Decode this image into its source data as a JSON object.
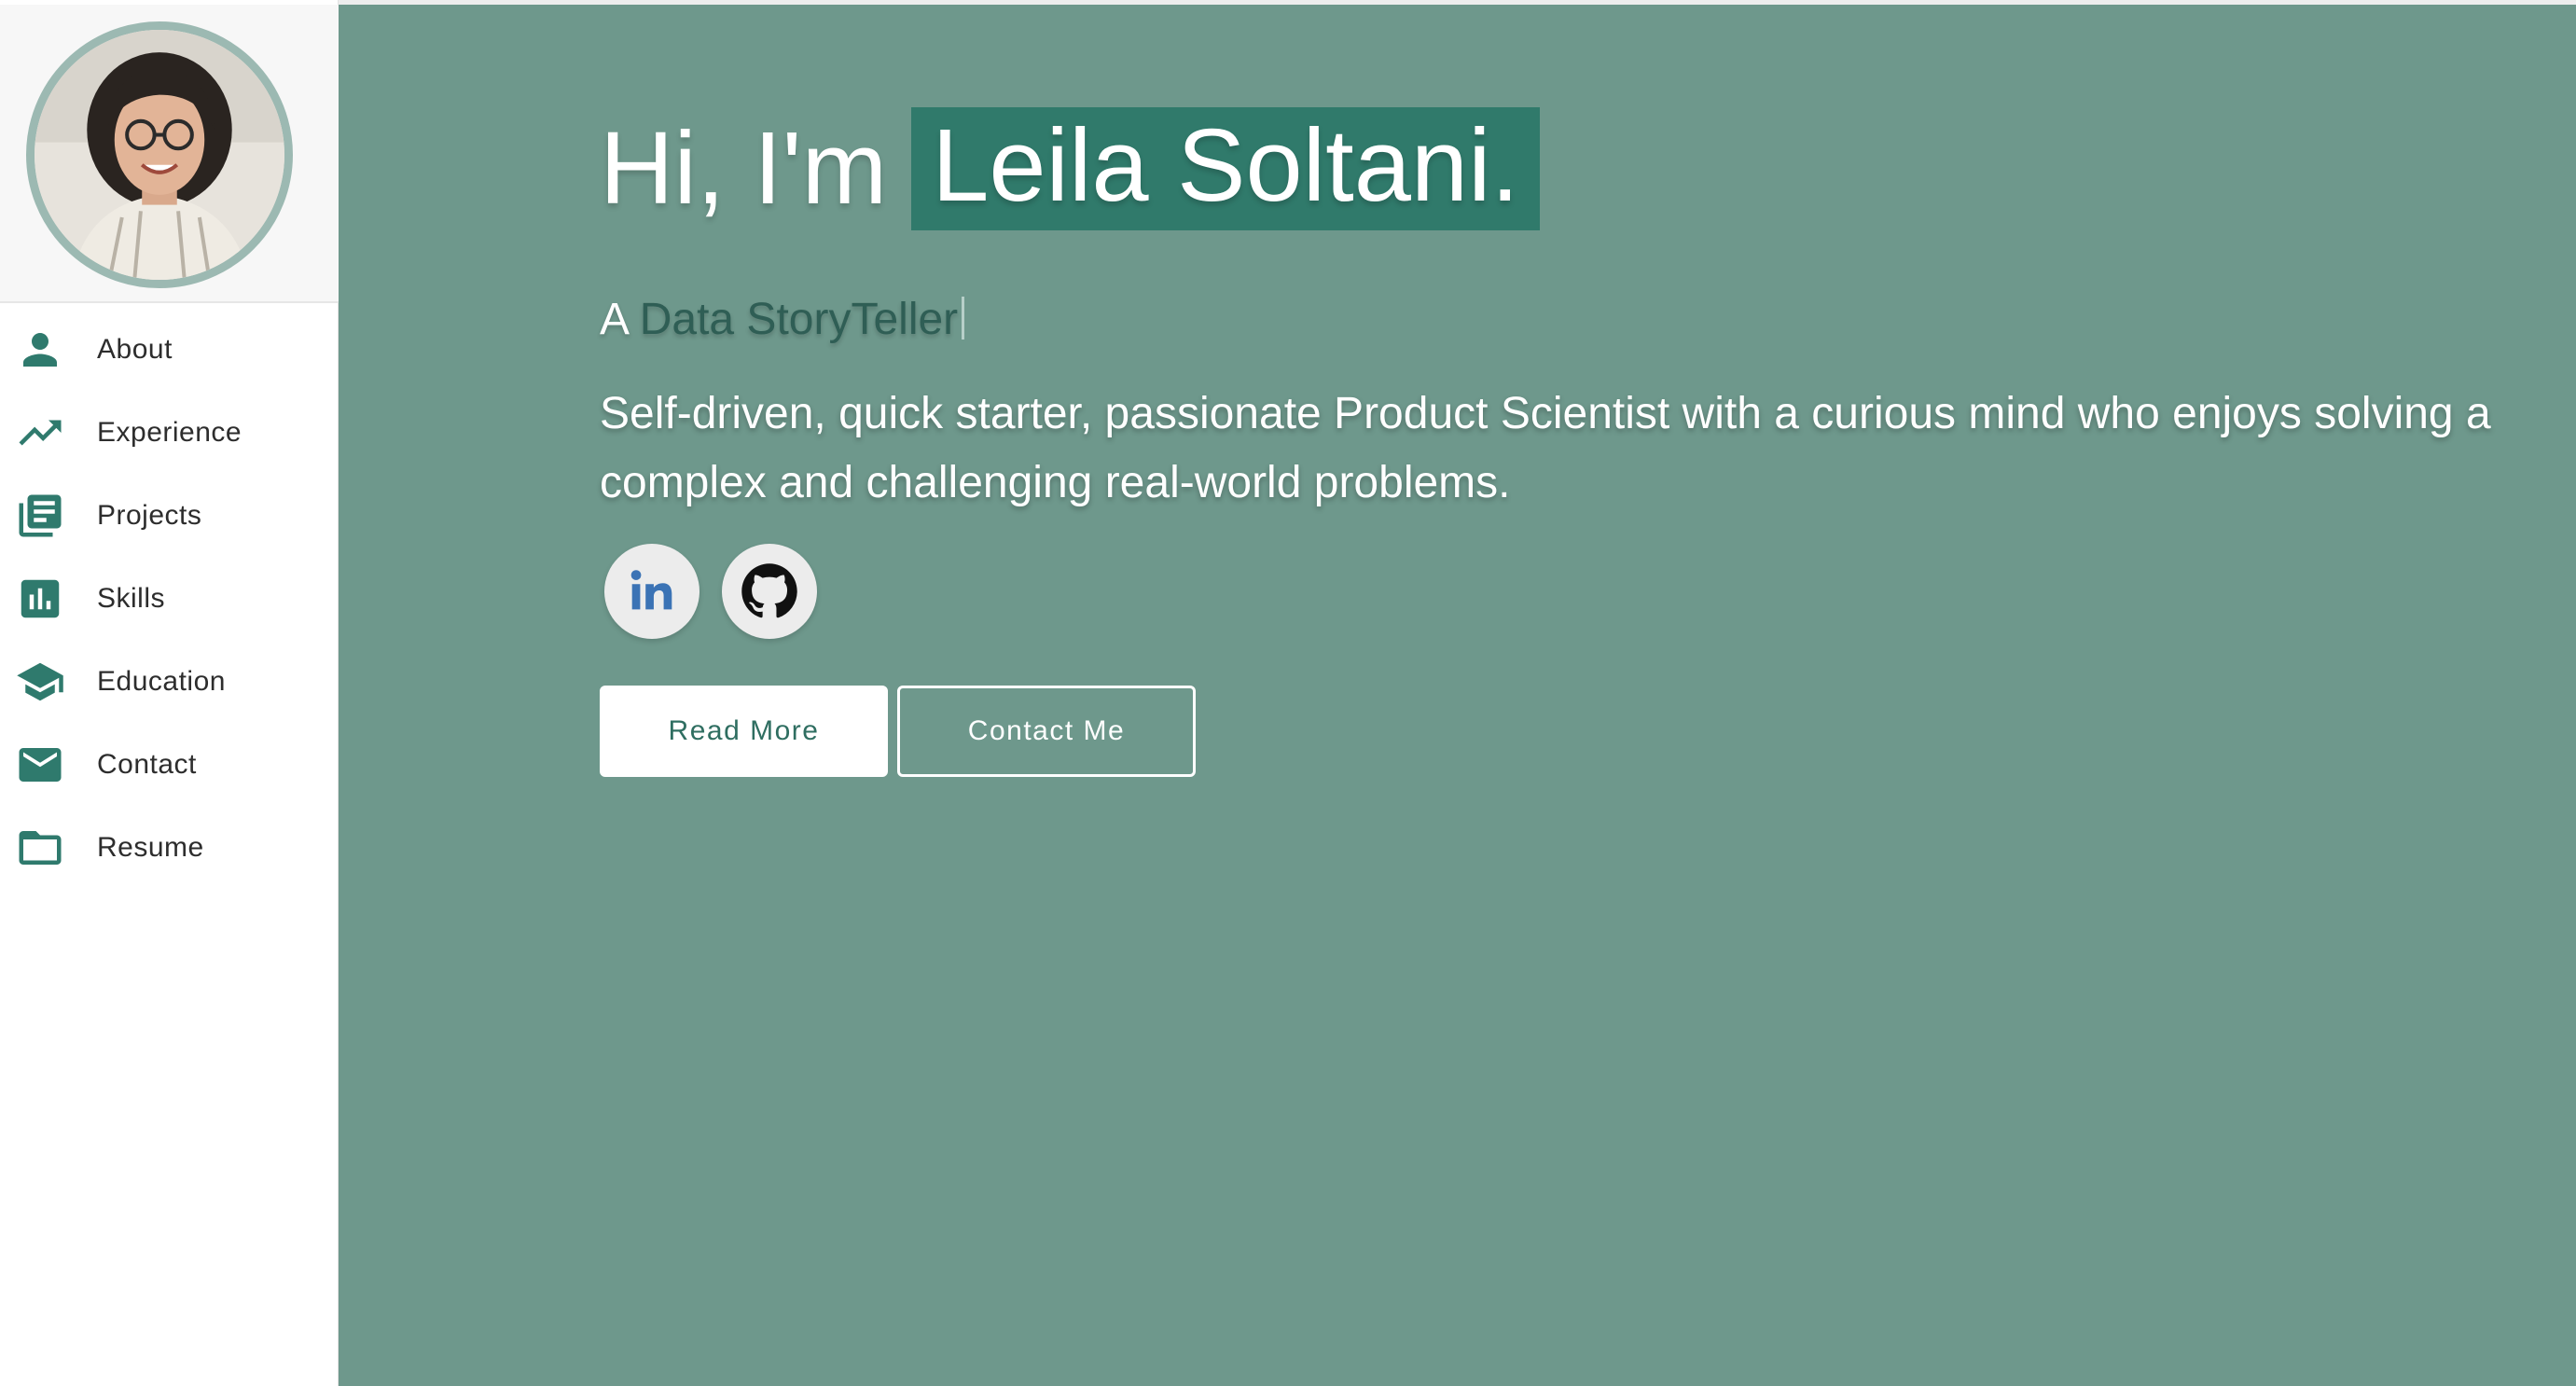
{
  "sidebar": {
    "items": [
      {
        "label": "About",
        "icon": "person-icon"
      },
      {
        "label": "Experience",
        "icon": "trending-up-icon"
      },
      {
        "label": "Projects",
        "icon": "library-books-icon"
      },
      {
        "label": "Skills",
        "icon": "bar-chart-icon"
      },
      {
        "label": "Education",
        "icon": "graduation-cap-icon"
      },
      {
        "label": "Contact",
        "icon": "mail-icon"
      },
      {
        "label": "Resume",
        "icon": "folder-icon"
      }
    ]
  },
  "hero": {
    "greeting": "Hi, I'm",
    "name": "Leila Soltani.",
    "tagline_prefix": "A ",
    "tagline_role": "Data StoryTeller",
    "bio": "Self-driven, quick starter, passionate Product Scientist with a curious mind who enjoys solving a complex and challenging real-world problems.",
    "socials": [
      {
        "icon": "linkedin-icon"
      },
      {
        "icon": "github-icon"
      }
    ],
    "buttons": {
      "read_more": "Read More",
      "contact_me": "Contact Me"
    }
  },
  "colors": {
    "accent": "#2f7a6d",
    "hero_background": "#6e988c",
    "name_highlight": "#307a6b",
    "avatar_ring": "#9cb9b2"
  }
}
